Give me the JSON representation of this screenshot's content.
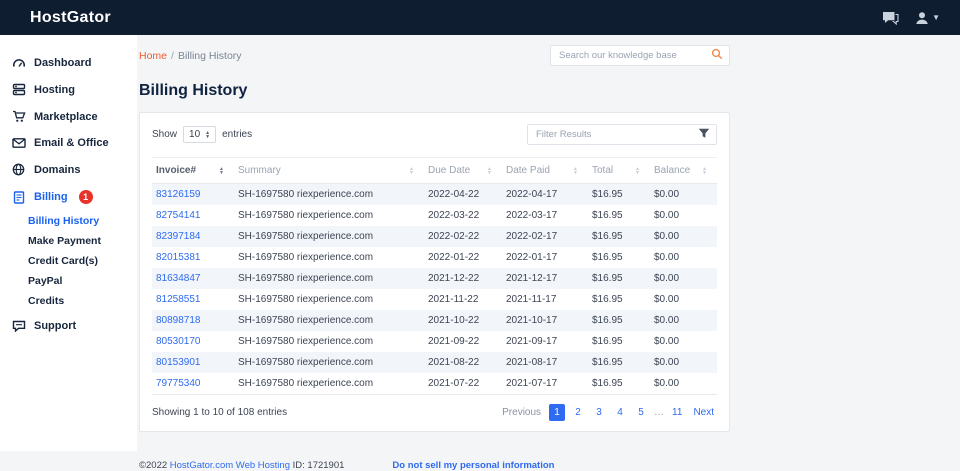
{
  "topbar": {
    "brand": "HostGator"
  },
  "icons": {
    "chat": "chat-bubble",
    "user": "person-silhouette",
    "caret": "▾",
    "search": "magnifier",
    "filter": "funnel",
    "sort": "up-down-triangles"
  },
  "colors": {
    "topbar_bg": "#0e1d30",
    "accent_blue": "#1b62f0",
    "link_blue": "#2e6bf0",
    "badge_red": "#e8332a",
    "breadcrumb_orange": "#ee5a2c",
    "row_stripe": "#f2f5fa"
  },
  "sidebar": {
    "items": [
      {
        "label": "Dashboard"
      },
      {
        "label": "Hosting"
      },
      {
        "label": "Marketplace"
      },
      {
        "label": "Email & Office"
      },
      {
        "label": "Domains"
      },
      {
        "label": "Billing",
        "badge": "1"
      },
      {
        "label": "Support"
      }
    ],
    "billing_sub": [
      {
        "label": "Billing History"
      },
      {
        "label": "Make Payment"
      },
      {
        "label": "Credit Card(s)"
      },
      {
        "label": "PayPal"
      },
      {
        "label": "Credits"
      }
    ]
  },
  "breadcrumb": {
    "home": "Home",
    "separator": "/",
    "current": "Billing History"
  },
  "search": {
    "placeholder": "Search our knowledge base"
  },
  "page_title": "Billing History",
  "table_controls": {
    "show_label": "Show",
    "show_value": "10",
    "entries_label": "entries",
    "filter_placeholder": "Filter Results"
  },
  "table": {
    "columns": [
      {
        "label": "Invoice#",
        "sorted": true
      },
      {
        "label": "Summary",
        "sorted": false
      },
      {
        "label": "Due Date",
        "sorted": false
      },
      {
        "label": "Date Paid",
        "sorted": false
      },
      {
        "label": "Total",
        "sorted": false
      },
      {
        "label": "Balance",
        "sorted": false
      }
    ],
    "rows": [
      [
        "83126159",
        "SH-1697580 riexperience.com",
        "2022-04-22",
        "2022-04-17",
        "$16.95",
        "$0.00"
      ],
      [
        "82754141",
        "SH-1697580 riexperience.com",
        "2022-03-22",
        "2022-03-17",
        "$16.95",
        "$0.00"
      ],
      [
        "82397184",
        "SH-1697580 riexperience.com",
        "2022-02-22",
        "2022-02-17",
        "$16.95",
        "$0.00"
      ],
      [
        "82015381",
        "SH-1697580 riexperience.com",
        "2022-01-22",
        "2022-01-17",
        "$16.95",
        "$0.00"
      ],
      [
        "81634847",
        "SH-1697580 riexperience.com",
        "2021-12-22",
        "2021-12-17",
        "$16.95",
        "$0.00"
      ],
      [
        "81258551",
        "SH-1697580 riexperience.com",
        "2021-11-22",
        "2021-11-17",
        "$16.95",
        "$0.00"
      ],
      [
        "80898718",
        "SH-1697580 riexperience.com",
        "2021-10-22",
        "2021-10-17",
        "$16.95",
        "$0.00"
      ],
      [
        "80530170",
        "SH-1697580 riexperience.com",
        "2021-09-22",
        "2021-09-17",
        "$16.95",
        "$0.00"
      ],
      [
        "80153901",
        "SH-1697580 riexperience.com",
        "2021-08-22",
        "2021-08-17",
        "$16.95",
        "$0.00"
      ],
      [
        "79775340",
        "SH-1697580 riexperience.com",
        "2021-07-22",
        "2021-07-17",
        "$16.95",
        "$0.00"
      ]
    ]
  },
  "table_footer": {
    "showing_text": "Showing 1 to 10 of 108 entries",
    "pagination": [
      {
        "label": "Previous",
        "kind": "prev"
      },
      {
        "label": "1",
        "kind": "page",
        "active": true
      },
      {
        "label": "2",
        "kind": "page"
      },
      {
        "label": "3",
        "kind": "page"
      },
      {
        "label": "4",
        "kind": "page"
      },
      {
        "label": "5",
        "kind": "page"
      },
      {
        "label": "…",
        "kind": "ellipsis"
      },
      {
        "label": "11",
        "kind": "page"
      },
      {
        "label": "Next",
        "kind": "next"
      }
    ]
  },
  "footer": {
    "copyright": "©2022",
    "hosting_link": "HostGator.com Web Hosting",
    "account_id": "ID: 1721901",
    "privacy_link": "Do not sell my personal information"
  }
}
